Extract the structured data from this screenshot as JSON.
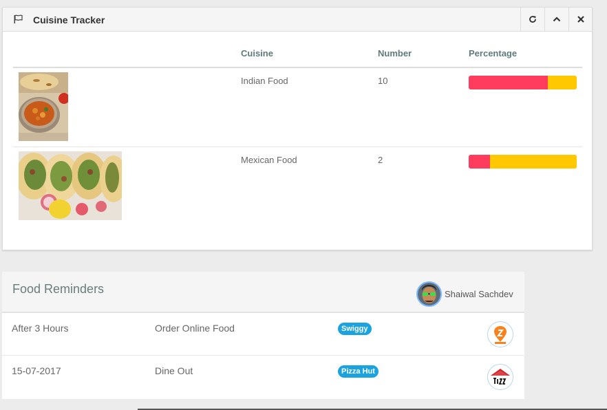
{
  "cuisine_panel": {
    "title": "Cuisine Tracker",
    "icons": [
      "flag-icon",
      "refresh-icon",
      "chevron-up-icon",
      "close-icon"
    ],
    "columns": [
      "",
      "Cuisine",
      "Number",
      "Percentage"
    ],
    "rows": [
      {
        "cuisine": "Indian Food",
        "number": "10",
        "percentage": 0.73
      },
      {
        "cuisine": "Mexican Food",
        "number": "2",
        "percentage": 0.2
      }
    ],
    "colors": {
      "bar_fill": "#ff3b5e",
      "bar_rest": "#ffc800"
    }
  },
  "reminders_panel": {
    "title": "Food Reminders",
    "user_name": "Shaiwal Sachdev",
    "rows": [
      {
        "time": "After 3 Hours",
        "task": "Order Online Food",
        "badge": "Swiggy",
        "logo": "swiggy-logo"
      },
      {
        "time": "15-07-2017",
        "task": "Dine Out",
        "badge": "Pizza Hut",
        "logo": "pizza-hut-logo"
      }
    ],
    "colors": {
      "badge": "#1ba3e0"
    }
  }
}
